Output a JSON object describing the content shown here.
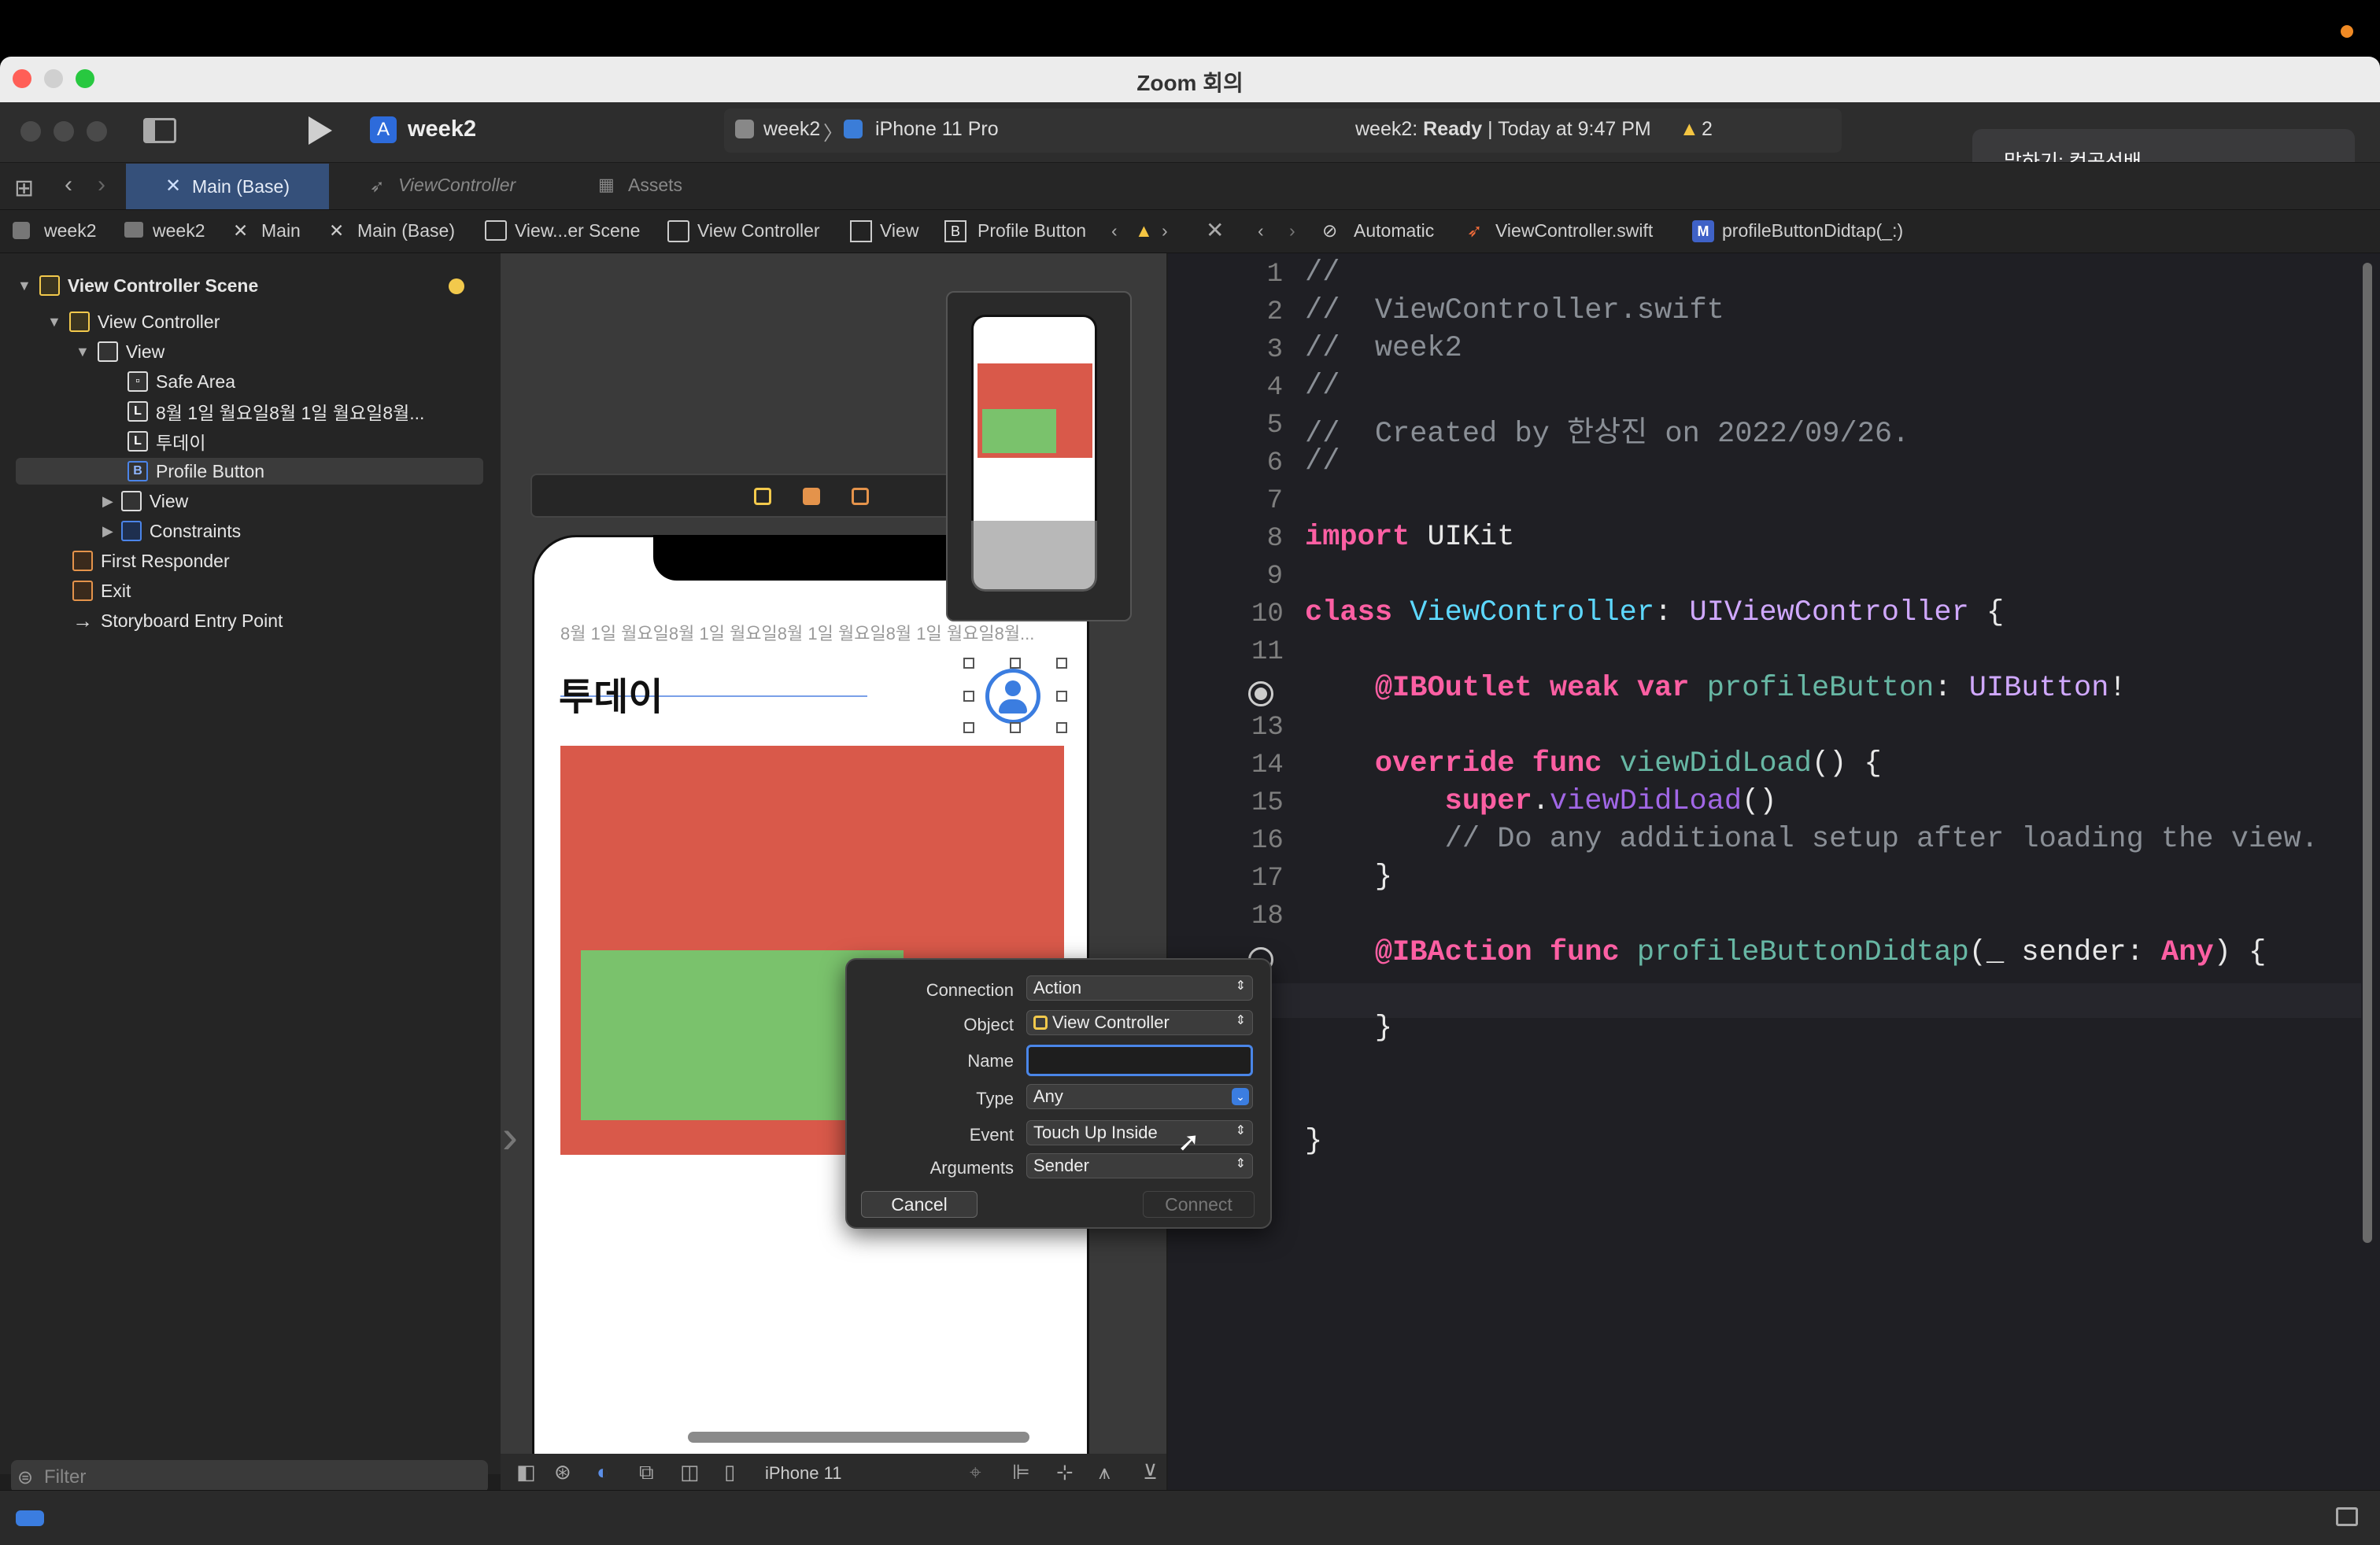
{
  "zoom": {
    "title": "Zoom 회의",
    "speaker_notice": "말하기: 컴공선배"
  },
  "toolbar": {
    "scheme": "week2",
    "scheme_target": "week2",
    "device": "iPhone 11 Pro",
    "status_project": "week2:",
    "status_state": "Ready",
    "status_time": "| Today at 9:47 PM",
    "warning_count": "2"
  },
  "tabs": [
    {
      "label": "Main (Base)"
    },
    {
      "label": "ViewController"
    },
    {
      "label": "Assets"
    }
  ],
  "jumpbar": {
    "left": [
      "week2",
      "week2",
      "Main",
      "Main (Base)",
      "View...er Scene",
      "View Controller",
      "View",
      "Profile Button"
    ],
    "right": [
      "Automatic",
      "ViewController.swift",
      "profileButtonDidtap(_:)"
    ]
  },
  "navigator": {
    "items": [
      {
        "label": "View Controller Scene",
        "icon": "scene-icon"
      },
      {
        "label": "View Controller",
        "icon": "view-controller-icon"
      },
      {
        "label": "View",
        "icon": "view-icon"
      },
      {
        "label": "Safe Area",
        "icon": "safe-area-icon"
      },
      {
        "label": "8월 1일 월요일8월 1일 월요일8월...",
        "icon": "label-icon",
        "glyph": "L"
      },
      {
        "label": "투데이",
        "icon": "label-icon",
        "glyph": "L"
      },
      {
        "label": "Profile Button",
        "icon": "button-icon",
        "glyph": "B"
      },
      {
        "label": "View",
        "icon": "view-icon"
      },
      {
        "label": "Constraints",
        "icon": "constraints-icon"
      },
      {
        "label": "First Responder",
        "icon": "first-responder-icon"
      },
      {
        "label": "Exit",
        "icon": "exit-icon"
      },
      {
        "label": "Storyboard Entry Point",
        "icon": "arrow-right-icon"
      }
    ],
    "filter_placeholder": "Filter"
  },
  "canvas": {
    "date_label": "8월 1일 월요일8월 1일 월요일8월 1일 월요일8월 1일 월요일8월...",
    "title_label": "투데이",
    "device_footer": "iPhone 11",
    "colors": {
      "red": "#d9594a",
      "green": "#7ac26c"
    }
  },
  "popup": {
    "connection_label": "Connection",
    "connection_value": "Action",
    "object_label": "Object",
    "object_value": "View Controller",
    "name_label": "Name",
    "name_value": "",
    "type_label": "Type",
    "type_value": "Any",
    "event_label": "Event",
    "event_value": "Touch Up Inside",
    "arguments_label": "Arguments",
    "arguments_value": "Sender",
    "cancel": "Cancel",
    "connect": "Connect"
  },
  "code": {
    "line_numbers": [
      "1",
      "2",
      "3",
      "4",
      "5",
      "6",
      "7",
      "8",
      "9",
      "10",
      "11",
      "13",
      "14",
      "15",
      "16",
      "17",
      "18"
    ],
    "l1": "//",
    "l2": "//  ViewController.swift",
    "l3": "//  week2",
    "l4": "//",
    "l5": "//  Created by 한상진 on 2022/09/26.",
    "l6": "//",
    "l8_kw": "import",
    "l8_rest": " UIKit",
    "l10_kw": "class",
    "l10_name": " ViewController",
    "l10_colon": ": ",
    "l10_type": "UIViewController",
    "l10_brace": " {",
    "l12_attr": "@IBOutlet",
    "l12_kw": " weak var",
    "l12_name": " profileButton",
    "l12_colon": ": ",
    "l12_type": "UIButton",
    "l12_bang": "!",
    "l14_kw": "override func",
    "l14_name": " viewDidLoad",
    "l14_rest": "() {",
    "l15_kw": "super",
    "l15_dot": ".",
    "l15_name": "viewDidLoad",
    "l15_rest": "()",
    "l16": "// Do any additional setup after loading the view.",
    "l17": "}",
    "l19_attr": "@IBAction",
    "l19_kw": " func",
    "l19_name": " profileButtonDidtap",
    "l19_args": "(_ sender: ",
    "l19_type": "Any",
    "l19_rest": ") {",
    "l21": "}",
    "l23": "}"
  }
}
